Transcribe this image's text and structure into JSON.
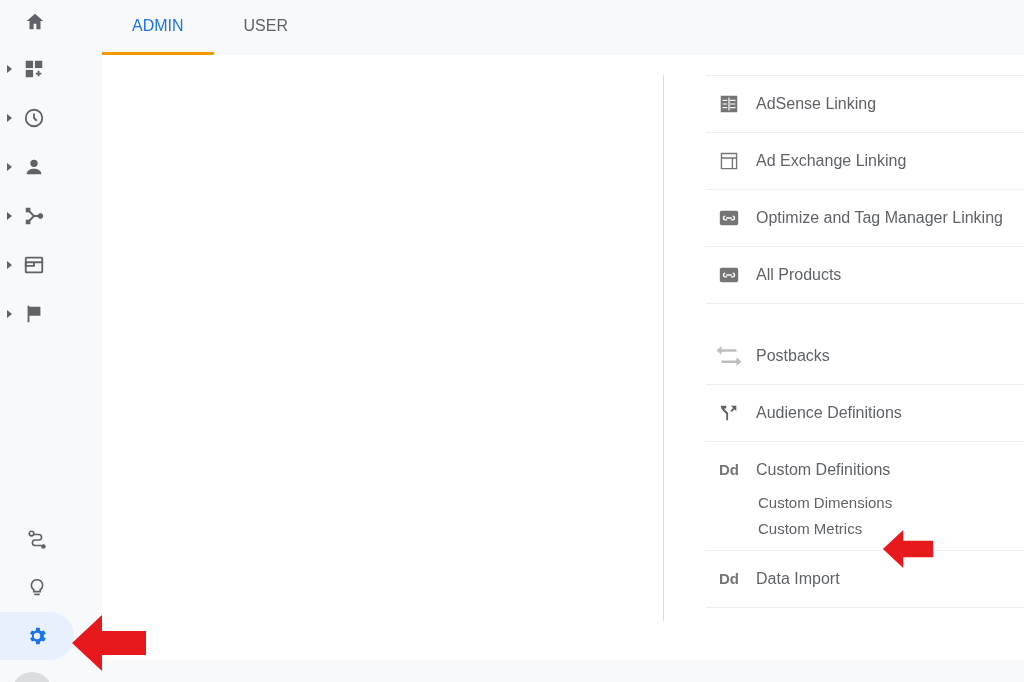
{
  "tabs": [
    {
      "label": "ADMIN",
      "selected": true
    },
    {
      "label": "USER",
      "selected": false
    }
  ],
  "sidebar": {
    "home": {
      "selected": false
    },
    "sections": [
      {
        "expanded": false
      },
      {
        "expanded": false
      },
      {
        "expanded": false
      },
      {
        "expanded": false
      },
      {
        "expanded": false
      },
      {
        "expanded": false
      }
    ],
    "bottom": [
      {
        "selected": false
      },
      {
        "selected": false
      },
      {
        "selected": true
      }
    ]
  },
  "property_groups": [
    [
      {
        "label": "AdSense Linking"
      },
      {
        "label": "Ad Exchange Linking"
      },
      {
        "label": "Optimize and Tag Manager Linking"
      },
      {
        "label": "All Products"
      }
    ],
    [
      {
        "label": "Postbacks"
      },
      {
        "label": "Audience Definitions"
      },
      {
        "label": "Custom Definitions",
        "glyph": "Dd",
        "children": [
          {
            "label": "Custom Dimensions"
          },
          {
            "label": "Custom Metrics"
          }
        ]
      },
      {
        "label": "Data Import",
        "glyph": "Dd"
      }
    ]
  ]
}
